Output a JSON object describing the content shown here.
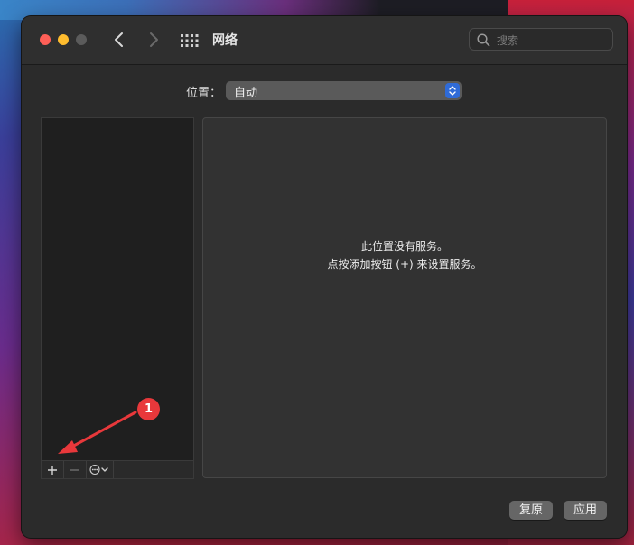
{
  "window": {
    "title": "网络",
    "search_placeholder": "搜索"
  },
  "location": {
    "label": "位置：",
    "value": "自动"
  },
  "services": {
    "items": [],
    "empty_line1": "此位置没有服务。",
    "empty_line2": "点按添加按钮 (+) 来设置服务。"
  },
  "list_toolbar": {
    "add_icon": "plus-icon",
    "remove_icon": "minus-icon",
    "action_icon": "ellipsis-circle-icon"
  },
  "buttons": {
    "revert": "复原",
    "apply": "应用"
  },
  "annotation": {
    "badge_number": "1",
    "color": "#e8383b"
  },
  "colors": {
    "close": "#fe5f57",
    "minimize": "#febc2e",
    "accent": "#2f6bd8"
  }
}
